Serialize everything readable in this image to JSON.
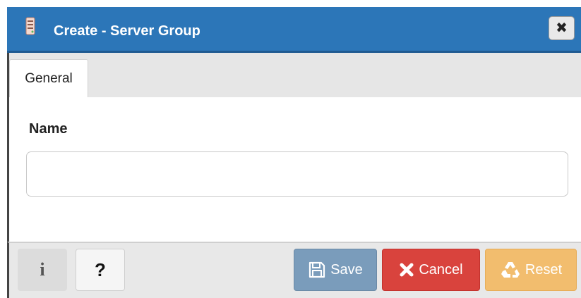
{
  "dialog": {
    "title": "Create - Server Group",
    "title_icon": "server-group-icon",
    "close_icon": "close-icon",
    "close_glyph": "✖"
  },
  "tabs": [
    {
      "label": "General",
      "active": true
    }
  ],
  "form": {
    "name_label": "Name",
    "name_value": "",
    "name_placeholder": ""
  },
  "footer": {
    "info_glyph": "i",
    "help_glyph": "?",
    "save_label": "Save",
    "cancel_label": "Cancel",
    "reset_label": "Reset"
  },
  "colors": {
    "titlebar": "#2c76b8",
    "save": "#7a9cbb",
    "cancel": "#d9433d",
    "reset": "#f2bd6e"
  }
}
